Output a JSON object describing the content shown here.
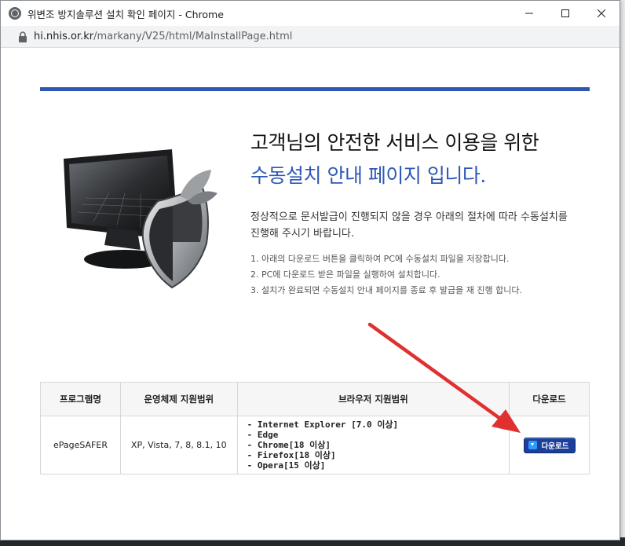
{
  "window": {
    "title": "위변조 방지솔루션 설치 확인 페이지 - Chrome",
    "url_host": "hi.nhis.or.kr",
    "url_path": "/markany/V25/html/MaInstallPage.html"
  },
  "page": {
    "headline_line1": "고객님의 안전한 서비스 이용을 위한",
    "headline_line2": "수동설치 안내 페이지 입니다.",
    "description_line1": "정상적으로 문서발급이 진행되지 않을 경우 아래의 절차에 따라 수동설치를",
    "description_line2": "진행해 주시기 바랍니다.",
    "steps": [
      "1. 아래의 다운로드 버튼을 클릭하여 PC에 수동설치 파일을 저장합니다.",
      "2. PC에 다운로드 받은 파일을 실행하여 설치합니다.",
      "3. 설치가 완료되면 수동설치 안내 페이지를 종료 후 발급을 재 진행 합니다."
    ]
  },
  "table": {
    "headers": [
      "프로그램명",
      "운영체제 지원범위",
      "브라우저 지원범위",
      "다운로드"
    ],
    "row": {
      "program": "ePageSAFER",
      "os": "XP, Vista, 7, 8, 8.1, 10",
      "browsers": [
        "- Internet Explorer [7.0 이상]",
        "- Edge",
        "- Chrome[18 이상]",
        "- Firefox[18 이상]",
        "- Opera[15 이상]"
      ],
      "download_label": "다운로드"
    }
  },
  "colors": {
    "accent_blue": "#2e58b4",
    "button_blue": "#1e3f99",
    "annotation_arrow": "#e03030"
  },
  "icons": [
    "globe-icon",
    "minimize-icon",
    "maximize-icon",
    "close-icon",
    "lock-icon",
    "download-icon",
    "monitor-shield-illustration",
    "annotation-arrow"
  ]
}
